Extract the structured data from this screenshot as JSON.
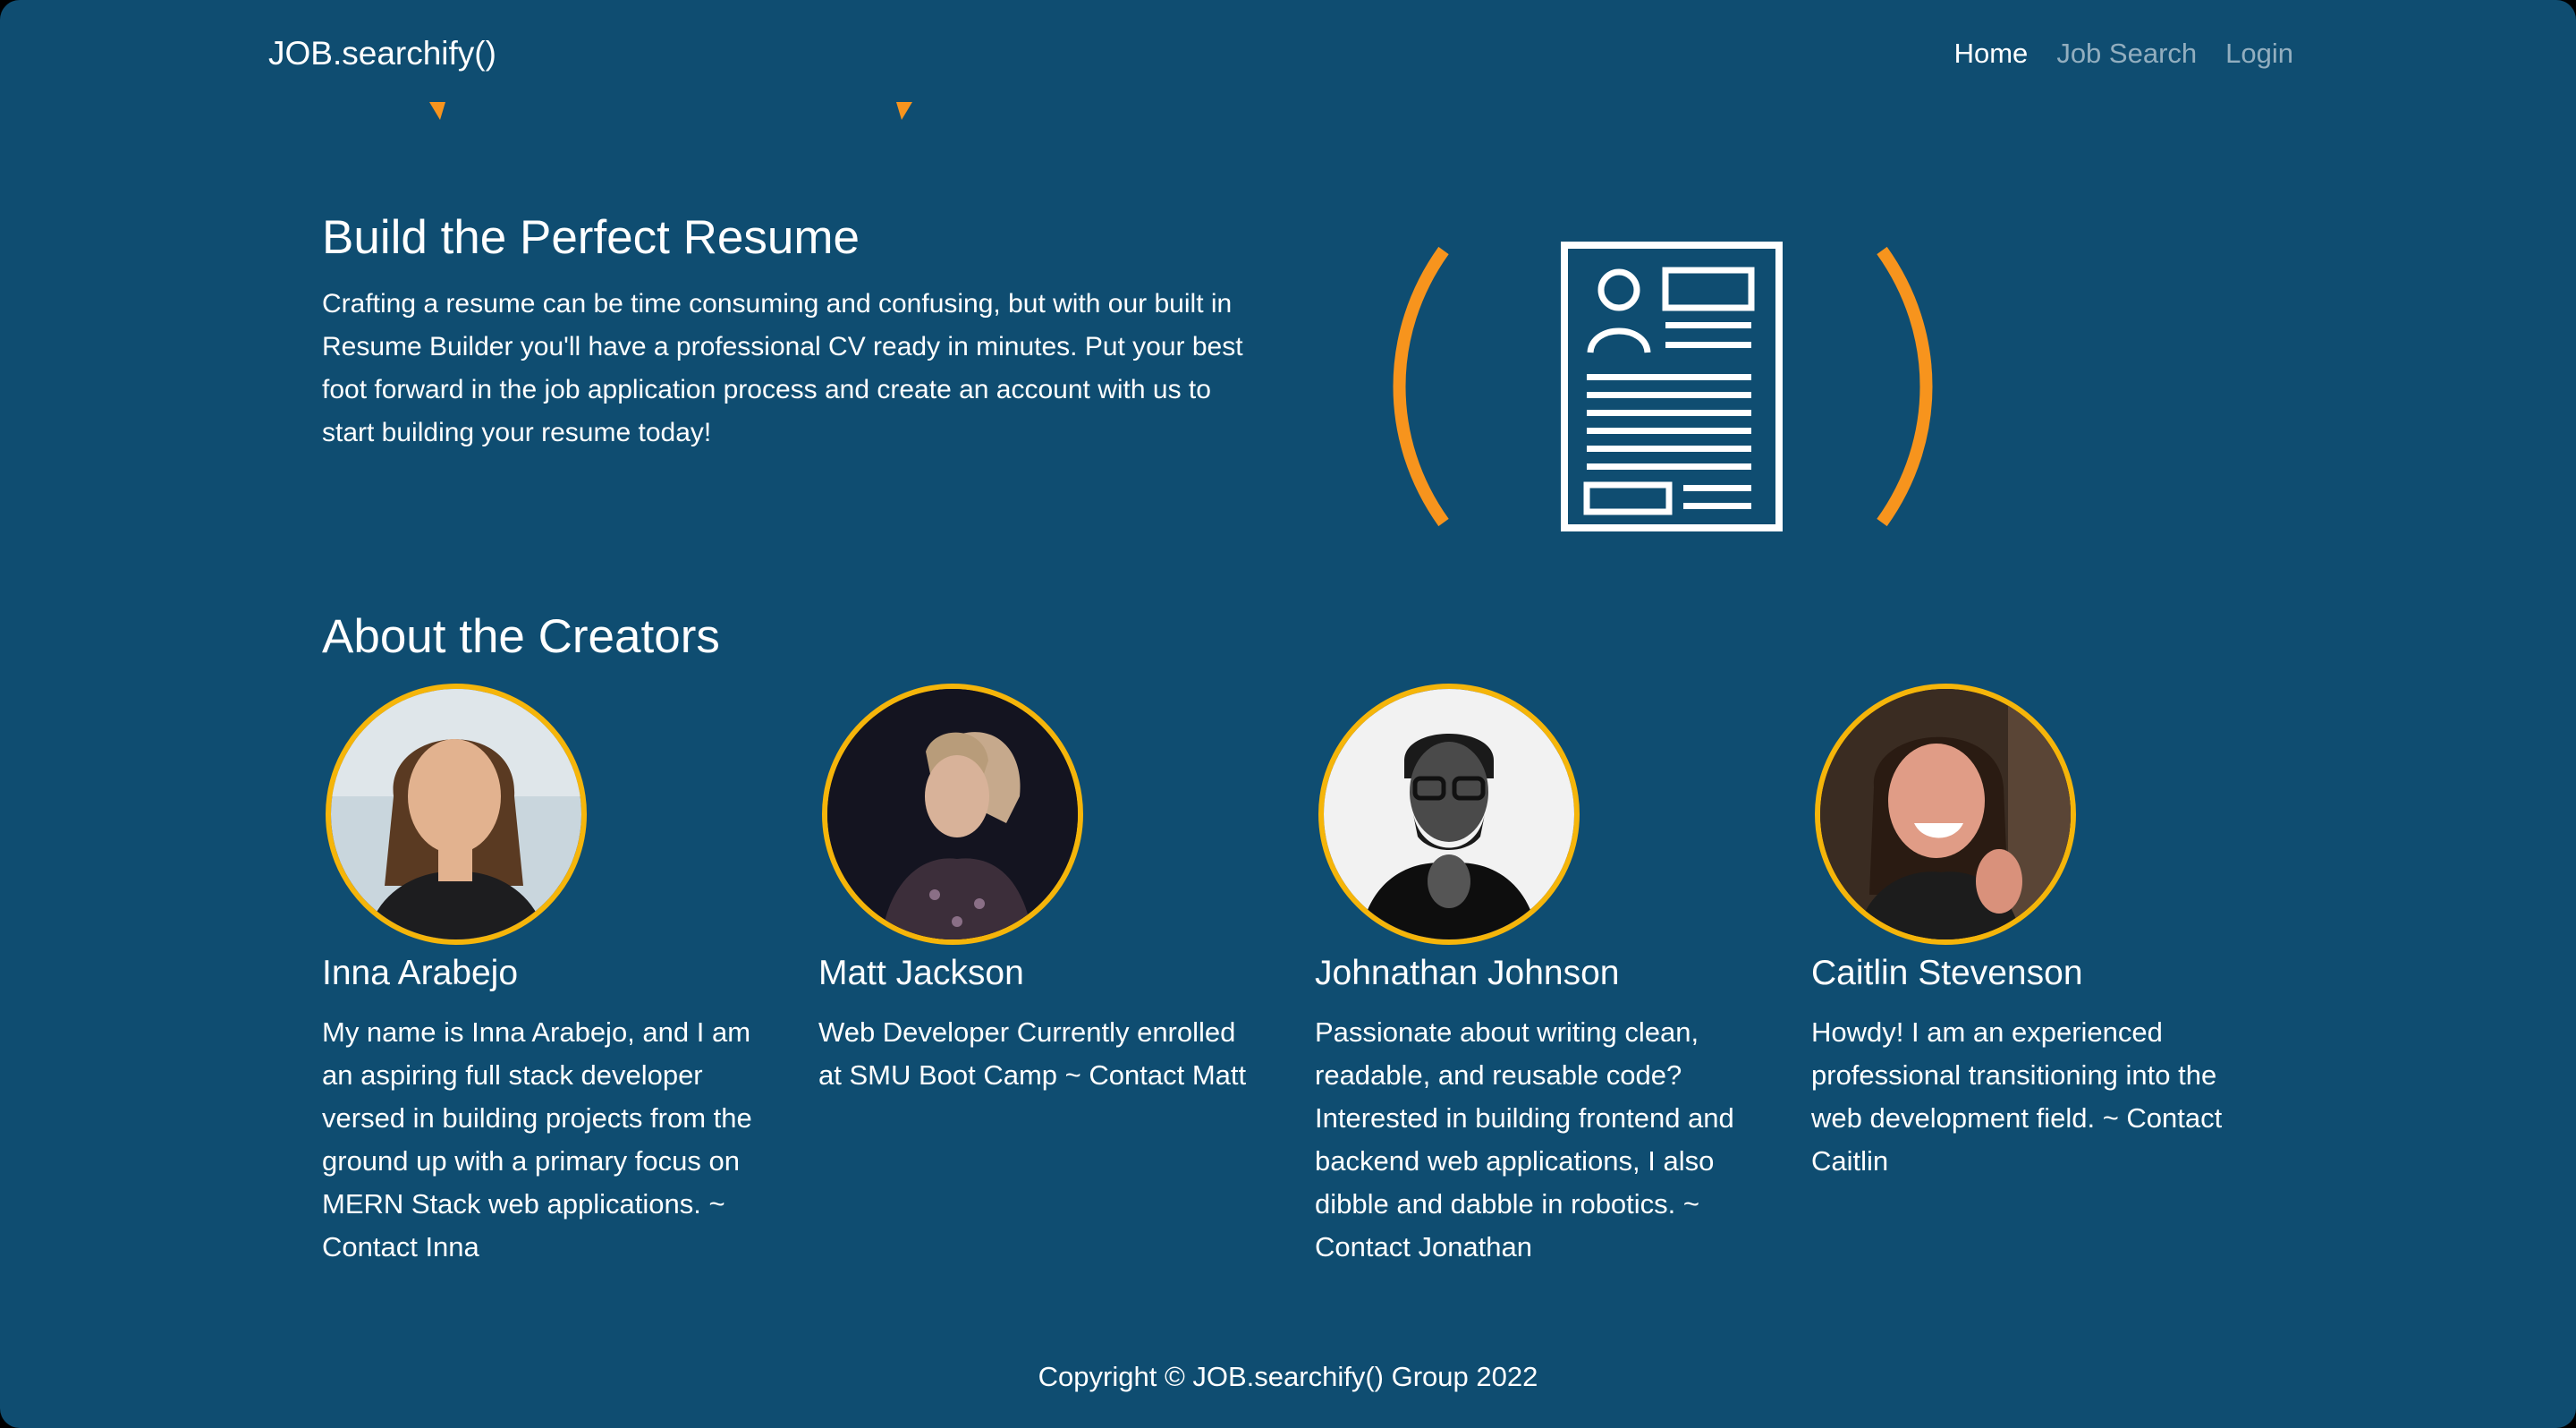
{
  "navbar": {
    "brand": "JOB.searchify()",
    "links": [
      "Home",
      "Job Search",
      "Login"
    ]
  },
  "resume": {
    "title": "Build the Perfect Resume",
    "text": "Crafting a resume can be time consuming and confusing, but with our built in Resume Builder you'll have a professional CV ready in minutes. Put your best foot forward in the job application process and create an account with us to start building your resume today!",
    "graphic_icon": "resume-document-icon"
  },
  "creators": {
    "title": "About the Creators",
    "people": [
      {
        "name": "Inna Arabejo",
        "bio": "My name is Inna Arabejo, and I am an aspiring full stack developer versed in building projects from the ground up with a primary focus on MERN Stack web applications. ~ Contact Inna"
      },
      {
        "name": "Matt Jackson",
        "bio": "Web Developer Currently enrolled at SMU Boot Camp ~ Contact Matt"
      },
      {
        "name": "Johnathan Johnson",
        "bio": "Passionate about writing clean, readable, and reusable code? Interested in building frontend and backend web applications, I also dibble and dabble in robotics. ~ Contact Jonathan"
      },
      {
        "name": "Caitlin Stevenson",
        "bio": "Howdy! I am an experienced professional transitioning into the web development field. ~ Contact Caitlin"
      }
    ]
  },
  "footer": {
    "copyright": "Copyright © JOB.searchify() Group 2022"
  },
  "colors": {
    "background": "#0f4d71",
    "accent": "#f7941d",
    "avatar_ring": "#f5b50a"
  }
}
